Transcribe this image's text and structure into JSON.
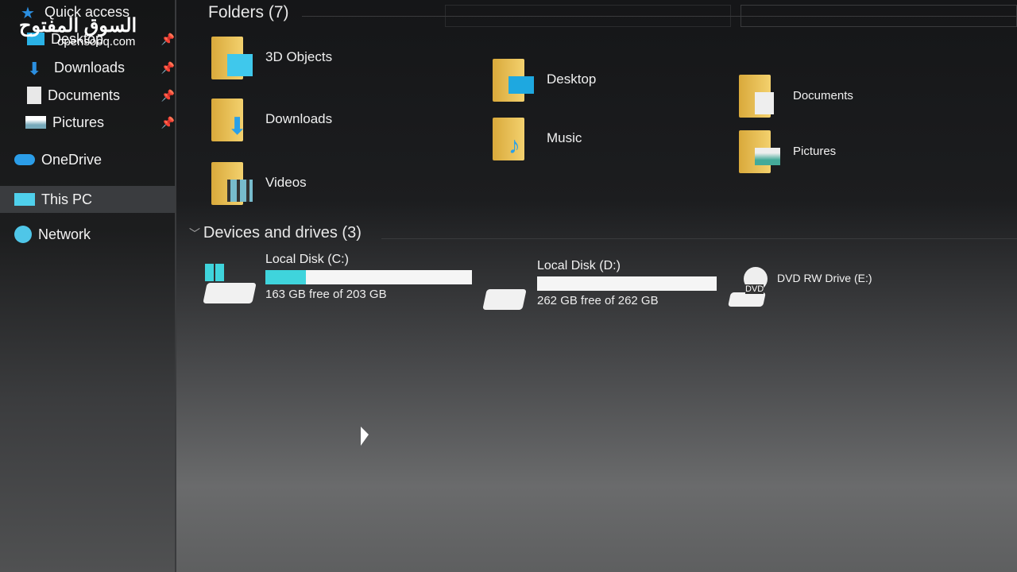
{
  "watermark": {
    "arabic": "السوق المفتوح",
    "latin": "opensooq.com"
  },
  "sidebar": {
    "items": [
      {
        "label": "Quick access",
        "icon": "star-icon"
      },
      {
        "label": "Desktop",
        "icon": "desktop-icon",
        "pinned": true
      },
      {
        "label": "Downloads",
        "icon": "download-arrow-icon",
        "pinned": true
      },
      {
        "label": "Documents",
        "icon": "document-icon",
        "pinned": true
      },
      {
        "label": "Pictures",
        "icon": "picture-icon",
        "pinned": true
      },
      {
        "label": "OneDrive",
        "icon": "cloud-icon"
      },
      {
        "label": "This PC",
        "icon": "computer-icon",
        "selected": true
      },
      {
        "label": "Network",
        "icon": "network-icon"
      }
    ]
  },
  "folders": {
    "header": "Folders (7)",
    "items": [
      {
        "label": "3D Objects"
      },
      {
        "label": "Desktop"
      },
      {
        "label": "Documents"
      },
      {
        "label": "Downloads"
      },
      {
        "label": "Music"
      },
      {
        "label": "Pictures"
      },
      {
        "label": "Videos"
      }
    ]
  },
  "drives": {
    "header": "Devices and drives (3)",
    "items": [
      {
        "label": "Local Disk (C:)",
        "free": "163 GB free of 203 GB",
        "used_percent": 19.7
      },
      {
        "label": "Local Disk (D:)",
        "free": "262 GB free of 262 GB",
        "used_percent": 0
      },
      {
        "label": "DVD RW Drive (E:)",
        "badge": "DVD"
      }
    ]
  },
  "colors": {
    "accent": "#3fd4dc",
    "folder": "#f3d16e"
  }
}
